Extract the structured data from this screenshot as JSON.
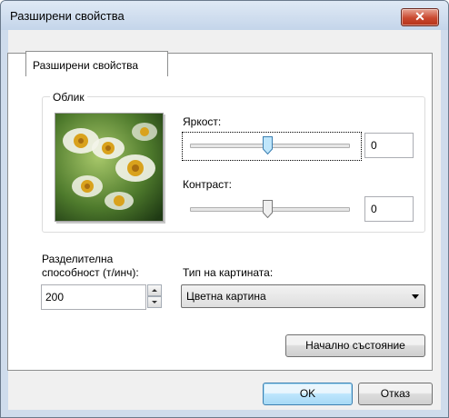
{
  "window": {
    "title": "Разширени свойства"
  },
  "tab": {
    "label": "Разширени свойства"
  },
  "group": {
    "label": "Облик"
  },
  "brightness": {
    "label": "Яркост:",
    "value": "0",
    "level": 0.5
  },
  "contrast": {
    "label": "Контраст:",
    "value": "0",
    "level": 0.5
  },
  "resolution": {
    "label_line1": "Разделителна",
    "label_line2": "способност (т/инч):",
    "value": "200"
  },
  "image_type": {
    "label": "Тип на картината:",
    "value": "Цветна картина"
  },
  "buttons": {
    "reset": "Начално състояние",
    "ok": "OK",
    "cancel": "Отказ"
  },
  "icons": {
    "close": "close-icon",
    "spin_up": "spin-up-icon",
    "spin_down": "spin-down-icon",
    "dropdown": "chevron-down-icon"
  },
  "colors": {
    "title_bg": "#cfdcec",
    "close_red": "#c9482f",
    "ok_blue": "#bee6fd"
  }
}
